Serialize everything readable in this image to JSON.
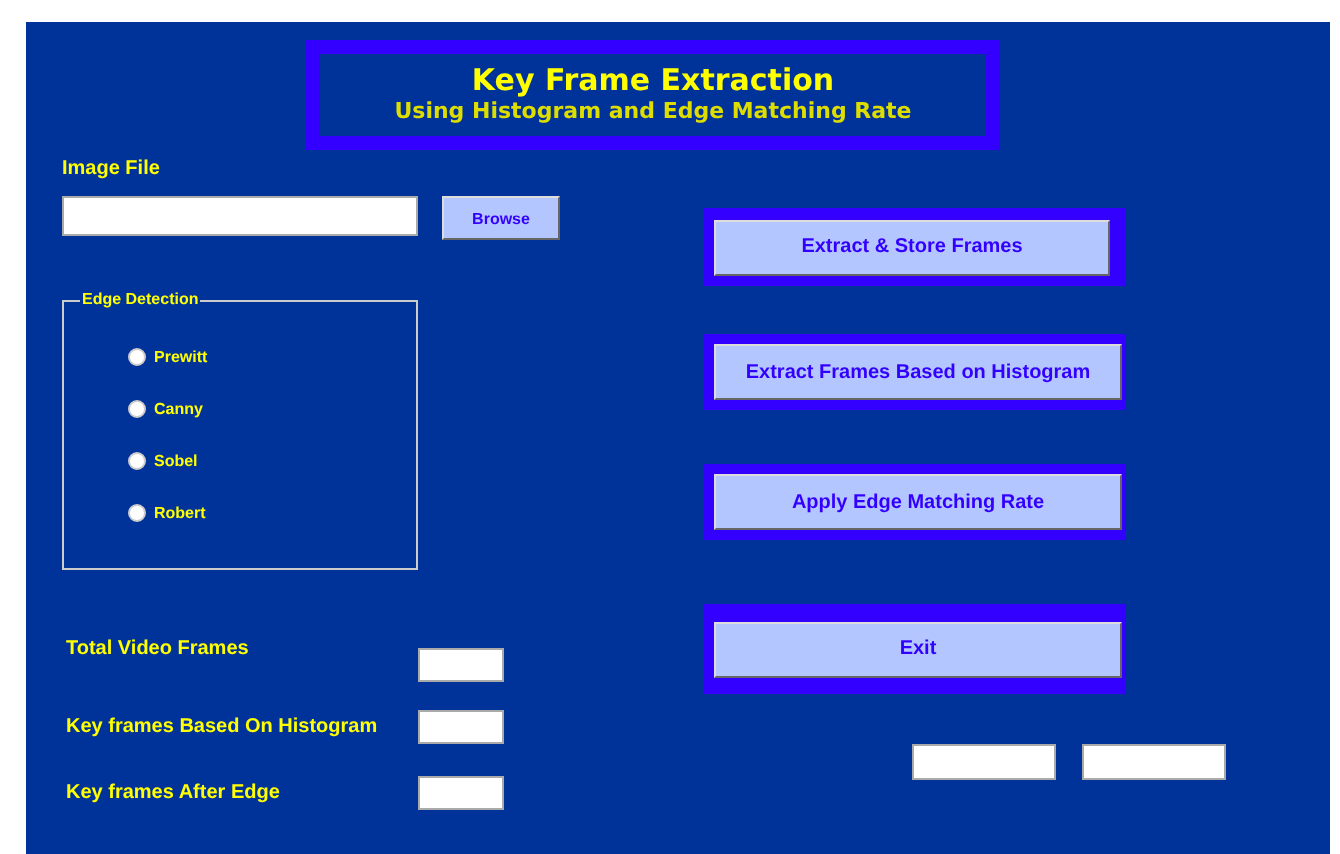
{
  "title": {
    "heading": "Key Frame Extraction",
    "subtitle": "Using Histogram and Edge Matching Rate"
  },
  "image_file": {
    "label": "Image File",
    "browse": "Browse"
  },
  "edge_detection": {
    "legend": "Edge Detection",
    "options": [
      {
        "label": "Prewitt",
        "selected": false
      },
      {
        "label": "Canny",
        "selected": false
      },
      {
        "label": "Sobel",
        "selected": false
      },
      {
        "label": "Robert",
        "selected": false
      }
    ]
  },
  "counts": [
    {
      "label": "Total Video Frames"
    },
    {
      "label": "Key frames Based On Histogram"
    },
    {
      "label": "Key frames After Edge"
    }
  ],
  "actions": [
    "Extract & Store Frames",
    "Extract Frames Based on Histogram",
    "Apply Edge Matching Rate",
    "Exit"
  ]
}
